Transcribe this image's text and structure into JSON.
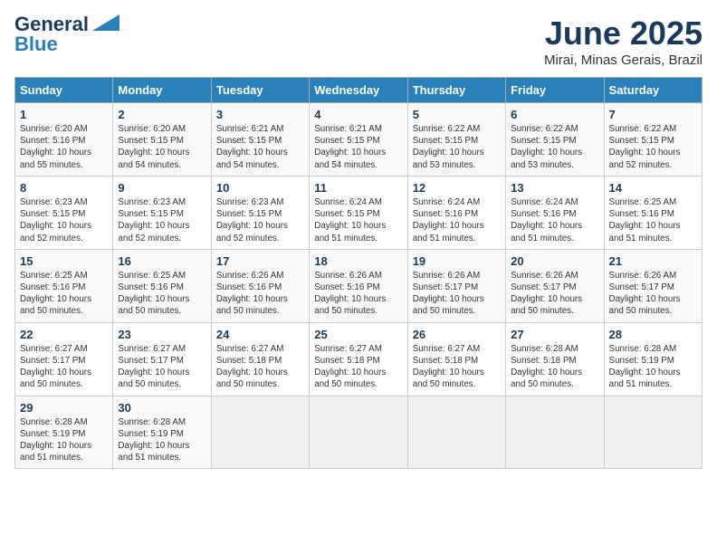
{
  "header": {
    "logo_line1": "General",
    "logo_line2": "Blue",
    "month_title": "June 2025",
    "location": "Mirai, Minas Gerais, Brazil"
  },
  "columns": [
    "Sunday",
    "Monday",
    "Tuesday",
    "Wednesday",
    "Thursday",
    "Friday",
    "Saturday"
  ],
  "weeks": [
    [
      {
        "day": "1",
        "sunrise": "6:20 AM",
        "sunset": "5:16 PM",
        "daylight": "10 hours and 55 minutes."
      },
      {
        "day": "2",
        "sunrise": "6:20 AM",
        "sunset": "5:15 PM",
        "daylight": "10 hours and 54 minutes."
      },
      {
        "day": "3",
        "sunrise": "6:21 AM",
        "sunset": "5:15 PM",
        "daylight": "10 hours and 54 minutes."
      },
      {
        "day": "4",
        "sunrise": "6:21 AM",
        "sunset": "5:15 PM",
        "daylight": "10 hours and 54 minutes."
      },
      {
        "day": "5",
        "sunrise": "6:22 AM",
        "sunset": "5:15 PM",
        "daylight": "10 hours and 53 minutes."
      },
      {
        "day": "6",
        "sunrise": "6:22 AM",
        "sunset": "5:15 PM",
        "daylight": "10 hours and 53 minutes."
      },
      {
        "day": "7",
        "sunrise": "6:22 AM",
        "sunset": "5:15 PM",
        "daylight": "10 hours and 52 minutes."
      }
    ],
    [
      {
        "day": "8",
        "sunrise": "6:23 AM",
        "sunset": "5:15 PM",
        "daylight": "10 hours and 52 minutes."
      },
      {
        "day": "9",
        "sunrise": "6:23 AM",
        "sunset": "5:15 PM",
        "daylight": "10 hours and 52 minutes."
      },
      {
        "day": "10",
        "sunrise": "6:23 AM",
        "sunset": "5:15 PM",
        "daylight": "10 hours and 52 minutes."
      },
      {
        "day": "11",
        "sunrise": "6:24 AM",
        "sunset": "5:15 PM",
        "daylight": "10 hours and 51 minutes."
      },
      {
        "day": "12",
        "sunrise": "6:24 AM",
        "sunset": "5:16 PM",
        "daylight": "10 hours and 51 minutes."
      },
      {
        "day": "13",
        "sunrise": "6:24 AM",
        "sunset": "5:16 PM",
        "daylight": "10 hours and 51 minutes."
      },
      {
        "day": "14",
        "sunrise": "6:25 AM",
        "sunset": "5:16 PM",
        "daylight": "10 hours and 51 minutes."
      }
    ],
    [
      {
        "day": "15",
        "sunrise": "6:25 AM",
        "sunset": "5:16 PM",
        "daylight": "10 hours and 50 minutes."
      },
      {
        "day": "16",
        "sunrise": "6:25 AM",
        "sunset": "5:16 PM",
        "daylight": "10 hours and 50 minutes."
      },
      {
        "day": "17",
        "sunrise": "6:26 AM",
        "sunset": "5:16 PM",
        "daylight": "10 hours and 50 minutes."
      },
      {
        "day": "18",
        "sunrise": "6:26 AM",
        "sunset": "5:16 PM",
        "daylight": "10 hours and 50 minutes."
      },
      {
        "day": "19",
        "sunrise": "6:26 AM",
        "sunset": "5:17 PM",
        "daylight": "10 hours and 50 minutes."
      },
      {
        "day": "20",
        "sunrise": "6:26 AM",
        "sunset": "5:17 PM",
        "daylight": "10 hours and 50 minutes."
      },
      {
        "day": "21",
        "sunrise": "6:26 AM",
        "sunset": "5:17 PM",
        "daylight": "10 hours and 50 minutes."
      }
    ],
    [
      {
        "day": "22",
        "sunrise": "6:27 AM",
        "sunset": "5:17 PM",
        "daylight": "10 hours and 50 minutes."
      },
      {
        "day": "23",
        "sunrise": "6:27 AM",
        "sunset": "5:17 PM",
        "daylight": "10 hours and 50 minutes."
      },
      {
        "day": "24",
        "sunrise": "6:27 AM",
        "sunset": "5:18 PM",
        "daylight": "10 hours and 50 minutes."
      },
      {
        "day": "25",
        "sunrise": "6:27 AM",
        "sunset": "5:18 PM",
        "daylight": "10 hours and 50 minutes."
      },
      {
        "day": "26",
        "sunrise": "6:27 AM",
        "sunset": "5:18 PM",
        "daylight": "10 hours and 50 minutes."
      },
      {
        "day": "27",
        "sunrise": "6:28 AM",
        "sunset": "5:18 PM",
        "daylight": "10 hours and 50 minutes."
      },
      {
        "day": "28",
        "sunrise": "6:28 AM",
        "sunset": "5:19 PM",
        "daylight": "10 hours and 51 minutes."
      }
    ],
    [
      {
        "day": "29",
        "sunrise": "6:28 AM",
        "sunset": "5:19 PM",
        "daylight": "10 hours and 51 minutes."
      },
      {
        "day": "30",
        "sunrise": "6:28 AM",
        "sunset": "5:19 PM",
        "daylight": "10 hours and 51 minutes."
      },
      null,
      null,
      null,
      null,
      null
    ]
  ]
}
